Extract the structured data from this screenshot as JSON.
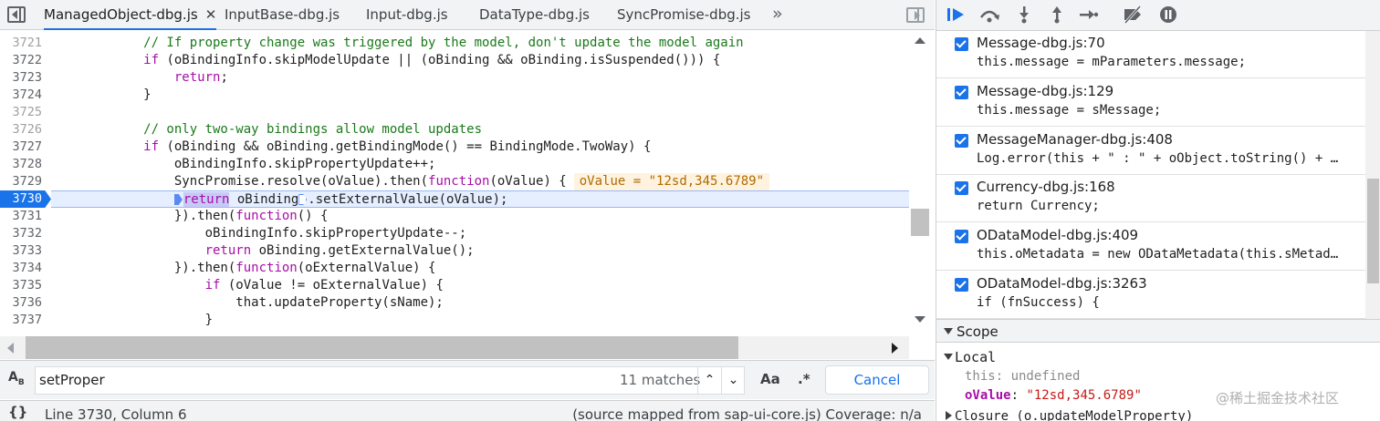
{
  "tabs": [
    {
      "label": "ManagedObject-dbg.js",
      "active": true,
      "closable": true
    },
    {
      "label": "InputBase-dbg.js",
      "active": false
    },
    {
      "label": "Input-dbg.js",
      "active": false
    },
    {
      "label": "DataType-dbg.js",
      "active": false
    },
    {
      "label": "SyncPromise-dbg.js",
      "active": false
    }
  ],
  "tab_more": "»",
  "tab_close": "✕",
  "editor": {
    "current_line": "3730",
    "lines": [
      {
        "num": "3721",
        "dim": true
      },
      {
        "num": "3722"
      },
      {
        "num": "3723"
      },
      {
        "num": "3724"
      },
      {
        "num": "3725",
        "dim": true
      },
      {
        "num": "3726",
        "dim": true
      },
      {
        "num": "3727"
      },
      {
        "num": "3728"
      },
      {
        "num": "3729"
      },
      {
        "num": "3730",
        "breakpoint": true
      },
      {
        "num": "3731"
      },
      {
        "num": "3732"
      },
      {
        "num": "3733"
      },
      {
        "num": "3734"
      },
      {
        "num": "3735"
      },
      {
        "num": "3736"
      },
      {
        "num": "3737"
      }
    ],
    "code": {
      "l3721": "            // If property change was triggered by the model, don't update the model again",
      "l3722_kw": "if",
      "l3722_rest": " (oBindingInfo.skipModelUpdate || (oBinding && oBinding.isSuspended())) {",
      "l3723_kw": "return",
      "l3723_rest": ";",
      "l3724": "            }",
      "l3726": "            // only two-way bindings allow model updates",
      "l3727_kw": "if",
      "l3727_rest": " (oBinding && oBinding.getBindingMode() == BindingMode.TwoWay) {",
      "l3728": "                oBindingInfo.skipPropertyUpdate++;",
      "l3729_pre": "                SyncPromise.resolve(oValue).then(",
      "l3729_kw": "function",
      "l3729_post": "(oValue) {",
      "l3729_inline": "oValue = \"12sd,345.6789\"",
      "l3730_kw": "return",
      "l3730_mid": " oBinding",
      "l3730_post": ".setExternalValue(oValue);",
      "l3731_pre": "                }).then(",
      "l3731_kw": "function",
      "l3731_post": "() {",
      "l3732": "                    oBindingInfo.skipPropertyUpdate--;",
      "l3733_kw": "return",
      "l3733_rest": " oBinding.getExternalValue();",
      "l3734_pre": "                }).then(",
      "l3734_kw": "function",
      "l3734_post": "(oExternalValue) {",
      "l3735_kw": "if",
      "l3735_rest": " (oValue != oExternalValue) {",
      "l3736": "                        that.updateProperty(sName);",
      "l3737": "                    }"
    }
  },
  "search": {
    "icon_label": "A",
    "icon_sub": "B",
    "value": "setProper",
    "matches": "11 matches",
    "up": "⌃",
    "down": "⌄",
    "case_label": "Aa",
    "regex_label": ".*",
    "cancel": "Cancel"
  },
  "status": {
    "braces": "{}",
    "position": "Line 3730, Column 6",
    "source": "(source mapped from sap-ui-core.js)  Coverage: n/a"
  },
  "debugger_icons": [
    "resume-icon",
    "step-over-icon",
    "step-into-icon",
    "step-out-icon",
    "step-icon",
    "deactivate-breakpoints-icon",
    "pause-on-exceptions-icon"
  ],
  "breakpoints": [
    {
      "title": "Message-dbg.js:70",
      "code": "this.message = mParameters.message;"
    },
    {
      "title": "Message-dbg.js:129",
      "code": "this.message = sMessage;"
    },
    {
      "title": "MessageManager-dbg.js:408",
      "code": "Log.error(this + \" : \" + oObject.toString() + …"
    },
    {
      "title": "Currency-dbg.js:168",
      "code": "return Currency;"
    },
    {
      "title": "ODataModel-dbg.js:409",
      "code": "this.oMetadata = new ODataMetadata(this.sMetad…"
    },
    {
      "title": "ODataModel-dbg.js:3263",
      "code": "if (fnSuccess) {"
    }
  ],
  "scope": {
    "header": "Scope",
    "local": "Local",
    "vars": [
      {
        "name": "this",
        "value": "undefined",
        "strong": false,
        "string": false
      },
      {
        "name": "oValue",
        "value": "\"12sd,345.6789\"",
        "strong": true,
        "string": true
      }
    ],
    "closure": "Closure (o.updateModelProperty)"
  },
  "watermark": "@稀土掘金技术社区",
  "colors": {
    "accent": "#1a73e8",
    "keyword": "#a80ea8",
    "comment": "#1a7a1a",
    "string": "#c41a16"
  }
}
